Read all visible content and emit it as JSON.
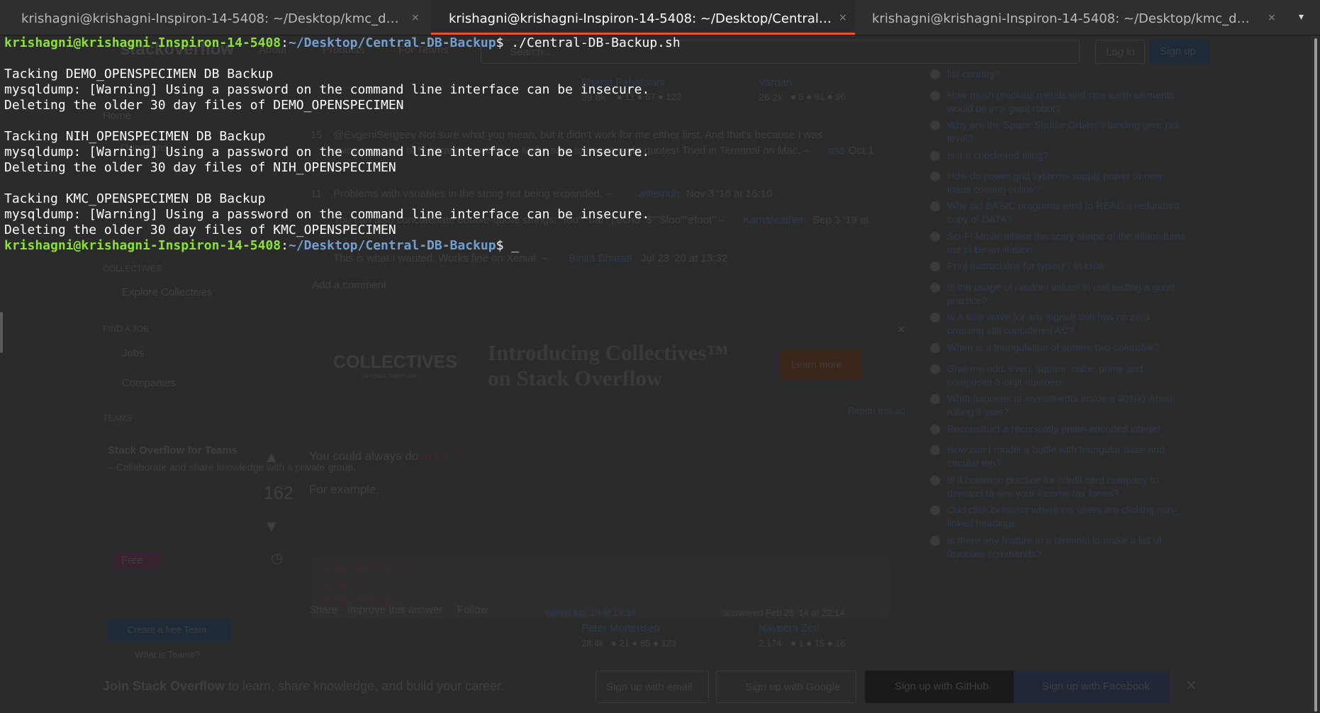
{
  "tabs": [
    {
      "title": "krishagni@krishagni-Inspiron-14-5408: ~/Desktop/kmc_dat…",
      "close": "×",
      "active": false
    },
    {
      "title": "krishagni@krishagni-Inspiron-14-5408: ~/Desktop/Central-…",
      "close": "×",
      "active": true
    },
    {
      "title": "krishagni@krishagni-Inspiron-14-5408: ~/Desktop/kmc_data…",
      "close": "×",
      "active": false
    }
  ],
  "tab_menu_glyph": "▾",
  "terminal": {
    "user_host": "krishagni@krishagni-Inspiron-14-5408",
    "cwd": "~/Desktop/Central-DB-Backup",
    "command": "./Central-DB-Backup.sh",
    "cursor": "_",
    "output_lines": [
      "",
      "Tacking DEMO_OPENSPECIMEN DB Backup",
      "mysqldump: [Warning] Using a password on the command line interface can be insecure.",
      "Deleting the older 30 day files of DEMO_OPENSPECIMEN",
      "",
      "Tacking NIH_OPENSPECIMEN DB Backup",
      "mysqldump: [Warning] Using a password on the command line interface can be insecure.",
      "Deleting the older 30 day files of NIH_OPENSPECIMEN",
      "",
      "Tacking KMC_OPENSPECIMEN DB Backup",
      "mysqldump: [Warning] Using a password on the command line interface can be insecure.",
      "Deleting the older 30 day files of KMC_OPENSPECIMEN"
    ]
  },
  "background_page": {
    "logo": "stackoverflow",
    "nav": [
      "About",
      "Products",
      "For Teams"
    ],
    "search_placeholder": "Search…",
    "login": "Log in",
    "signup": "Sign up",
    "sidebar": {
      "home": "Home",
      "questions": "Questions",
      "collectives_header": "COLLECTIVES",
      "explore_collectives": "Explore Collectives",
      "find_job_header": "FIND A JOB",
      "jobs": "Jobs",
      "companies": "Companies",
      "teams_header": "TEAMS",
      "teams_title": "Stack Overflow for Teams",
      "teams_text": " – Collaborate and share knowledge with a private group.",
      "free_badge": "Free",
      "create_team": "Create a free Team",
      "what_is_teams": "What is Teams?"
    },
    "top_users": [
      {
        "name": "Bharat Pahalwani",
        "rep": "29.6k",
        "badges": "● 11  ● 67  ● 123"
      },
      {
        "name": "Vardan",
        "rep": "26.2k",
        "badges": "● 5  ● 91  ● 96"
      }
    ],
    "comments": [
      {
        "score": "15",
        "text": "@EvgeniSergeev Not sure what you mean, but it didn't work for me either first. And that's because I was",
        "text2": "using ‘’ instead of \"\" (straight quotes)…. Make sure to use straight quotes! Tried in Terminal on Mac. –",
        "user": "trss",
        "date": "Oct 1"
      },
      {
        "score": "11",
        "text": "Problems with variables in the string not being expanded. –",
        "user": "willemdh",
        "date": "Nov 3 '16 at 16:10"
      },
      {
        "score": "",
        "text": "You can also concatenate double-quote strings: \"foo\" \"bar\" | echo \"$\"\"$foo\"\"efoot\" –",
        "user": "Kamafeather",
        "date": "Sep 3 '19 at"
      },
      {
        "score": "",
        "text": "This is what I wanted. Works fine on Xenial. –",
        "user": "Binita Bharati",
        "date": "Jul 23 '20 at 13:32"
      }
    ],
    "add_comment": "Add a comment",
    "ad": {
      "brand": "COLLECTIVES",
      "brand_sub": "ON STACK OVERFLOW",
      "title_line1": "Introducing Collectives™",
      "title_line2": "on Stack Overflow",
      "cta": "Learn more",
      "report": "Report this ad",
      "close": "✕"
    },
    "answer": {
      "score": "162",
      "text_pre": "You could always do ",
      "text_code": "echo \"\"",
      "text_post": ".",
      "example": "For example,",
      "code_lines": [
        "echo \"Hello,\"",
        "echo \"\"",
        "echo \"World!\""
      ],
      "actions": [
        "Share",
        "Improve this answer",
        "Follow"
      ],
      "edited": "edited Apr 19 at 19:18",
      "editor": "Peter Mortensen",
      "editor_rep": "28.4k",
      "editor_badges": "● 21  ● 85  ● 123",
      "answered": "answered Feb 28 '14 at 22:14",
      "answerer": "Nayeem Zen",
      "answerer_rep": "2,174",
      "answerer_badges": "● 1  ● 15  ● 16"
    },
    "related": [
      "list-country?",
      "How much precious metals and rare earth elements would be in a giant robot?",
      "Why are the Space Shuttle Orbiter's landing gear not level?",
      "Is it a checkered tiling?",
      "How do power grid systems supply power to new loads coming online?",
      "Why did BASIC programs tend to READ a redundant copy of DATA?",
      "Sci-Fi Movie where the scary shape of the aliens turns out to be an illusion",
      "Print instructions for typing \\' in chat",
      "Is the usage of random values in unit testing a good practice?",
      "Is a sine wave (or any signal) that has no zero crossing still considered AC?",
      "When is a triangulation of sphere two-colorable?",
      "Give me odd, even, square, cube, prime and composite 3-digit numbers",
      "What happens to investments inside a 401(k) when rolling it over?",
      "Reconstruct a recursively prime-encoded integer",
      "How can I model a bottle with triangular base and circular top?",
      "Is it common practice for credit card company to demand to see your income tax forms?",
      "Odd click behavior where my users are clicking non-linked headings",
      "Is there any feature in a terminal to make a list of favorites commands?"
    ],
    "join_bar": {
      "lead": "Join Stack Overflow",
      "text": " to learn, share knowledge, and build your career.",
      "email": "Sign up with email",
      "google": "Sign up with Google",
      "github": "Sign up with GitHub",
      "facebook": "Sign up with Facebook",
      "close": "✕"
    }
  }
}
